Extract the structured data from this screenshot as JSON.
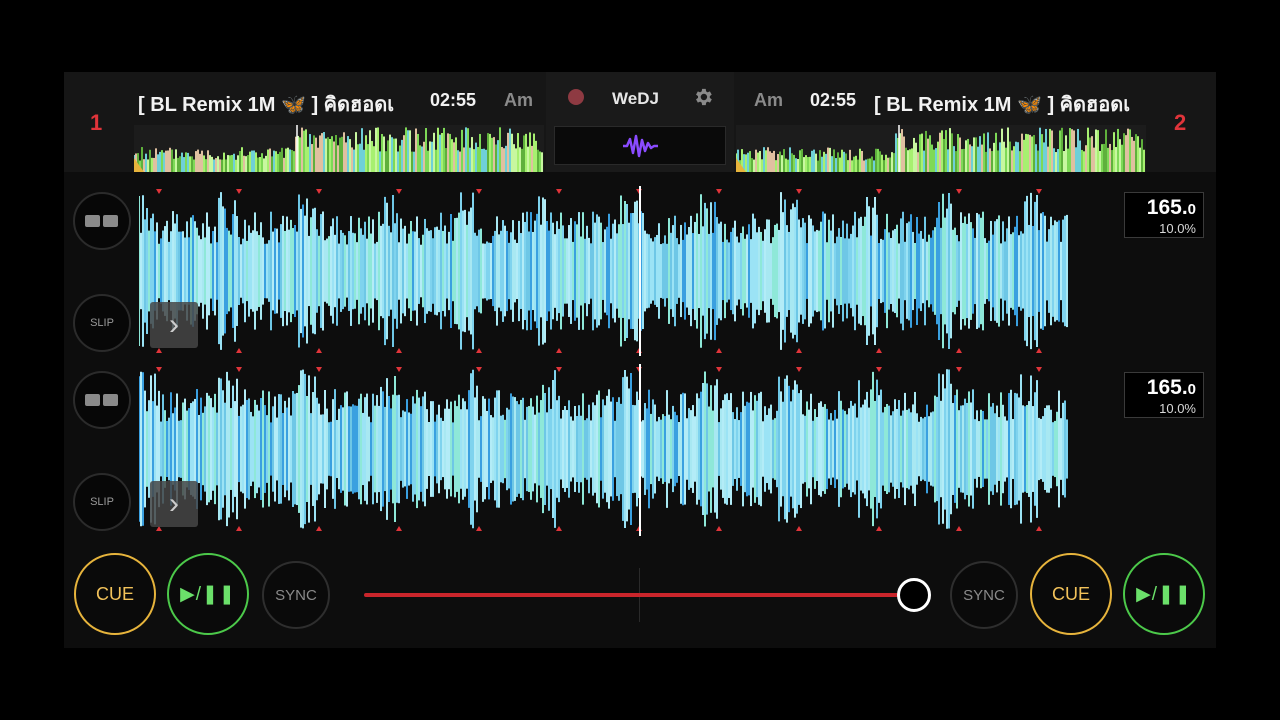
{
  "app": {
    "name": "WeDJ"
  },
  "decks": [
    {
      "number": "1",
      "title": "[ BL Remix 1M 🦋 ] คิดฮอดเ",
      "time": "02:55",
      "key": "Am"
    },
    {
      "number": "2",
      "title": "[ BL Remix 1M 🦋 ] คิดฮอดเ",
      "time": "02:55",
      "key": "Am"
    }
  ],
  "waveforms": [
    {
      "bpm_main": "165.",
      "bpm_decimal": "0",
      "pitch": "10.0%",
      "slip_label": "SLIP"
    },
    {
      "bpm_main": "165.",
      "bpm_decimal": "0",
      "pitch": "10.0%",
      "slip_label": "SLIP"
    }
  ],
  "transport": {
    "left": {
      "cue": "CUE",
      "play": "▶/❚❚",
      "sync": "SYNC"
    },
    "right": {
      "cue": "CUE",
      "play": "▶/❚❚",
      "sync": "SYNC"
    }
  },
  "crossfader": {
    "position": 1.0
  },
  "icons": {
    "settings": "gear-icon",
    "record": "record-icon",
    "waveform": "waveform-icon"
  },
  "colors": {
    "accent_red": "#e0343a",
    "cue": "#e7b43c",
    "play": "#4cc94a",
    "wave": "#8fdcf0"
  }
}
